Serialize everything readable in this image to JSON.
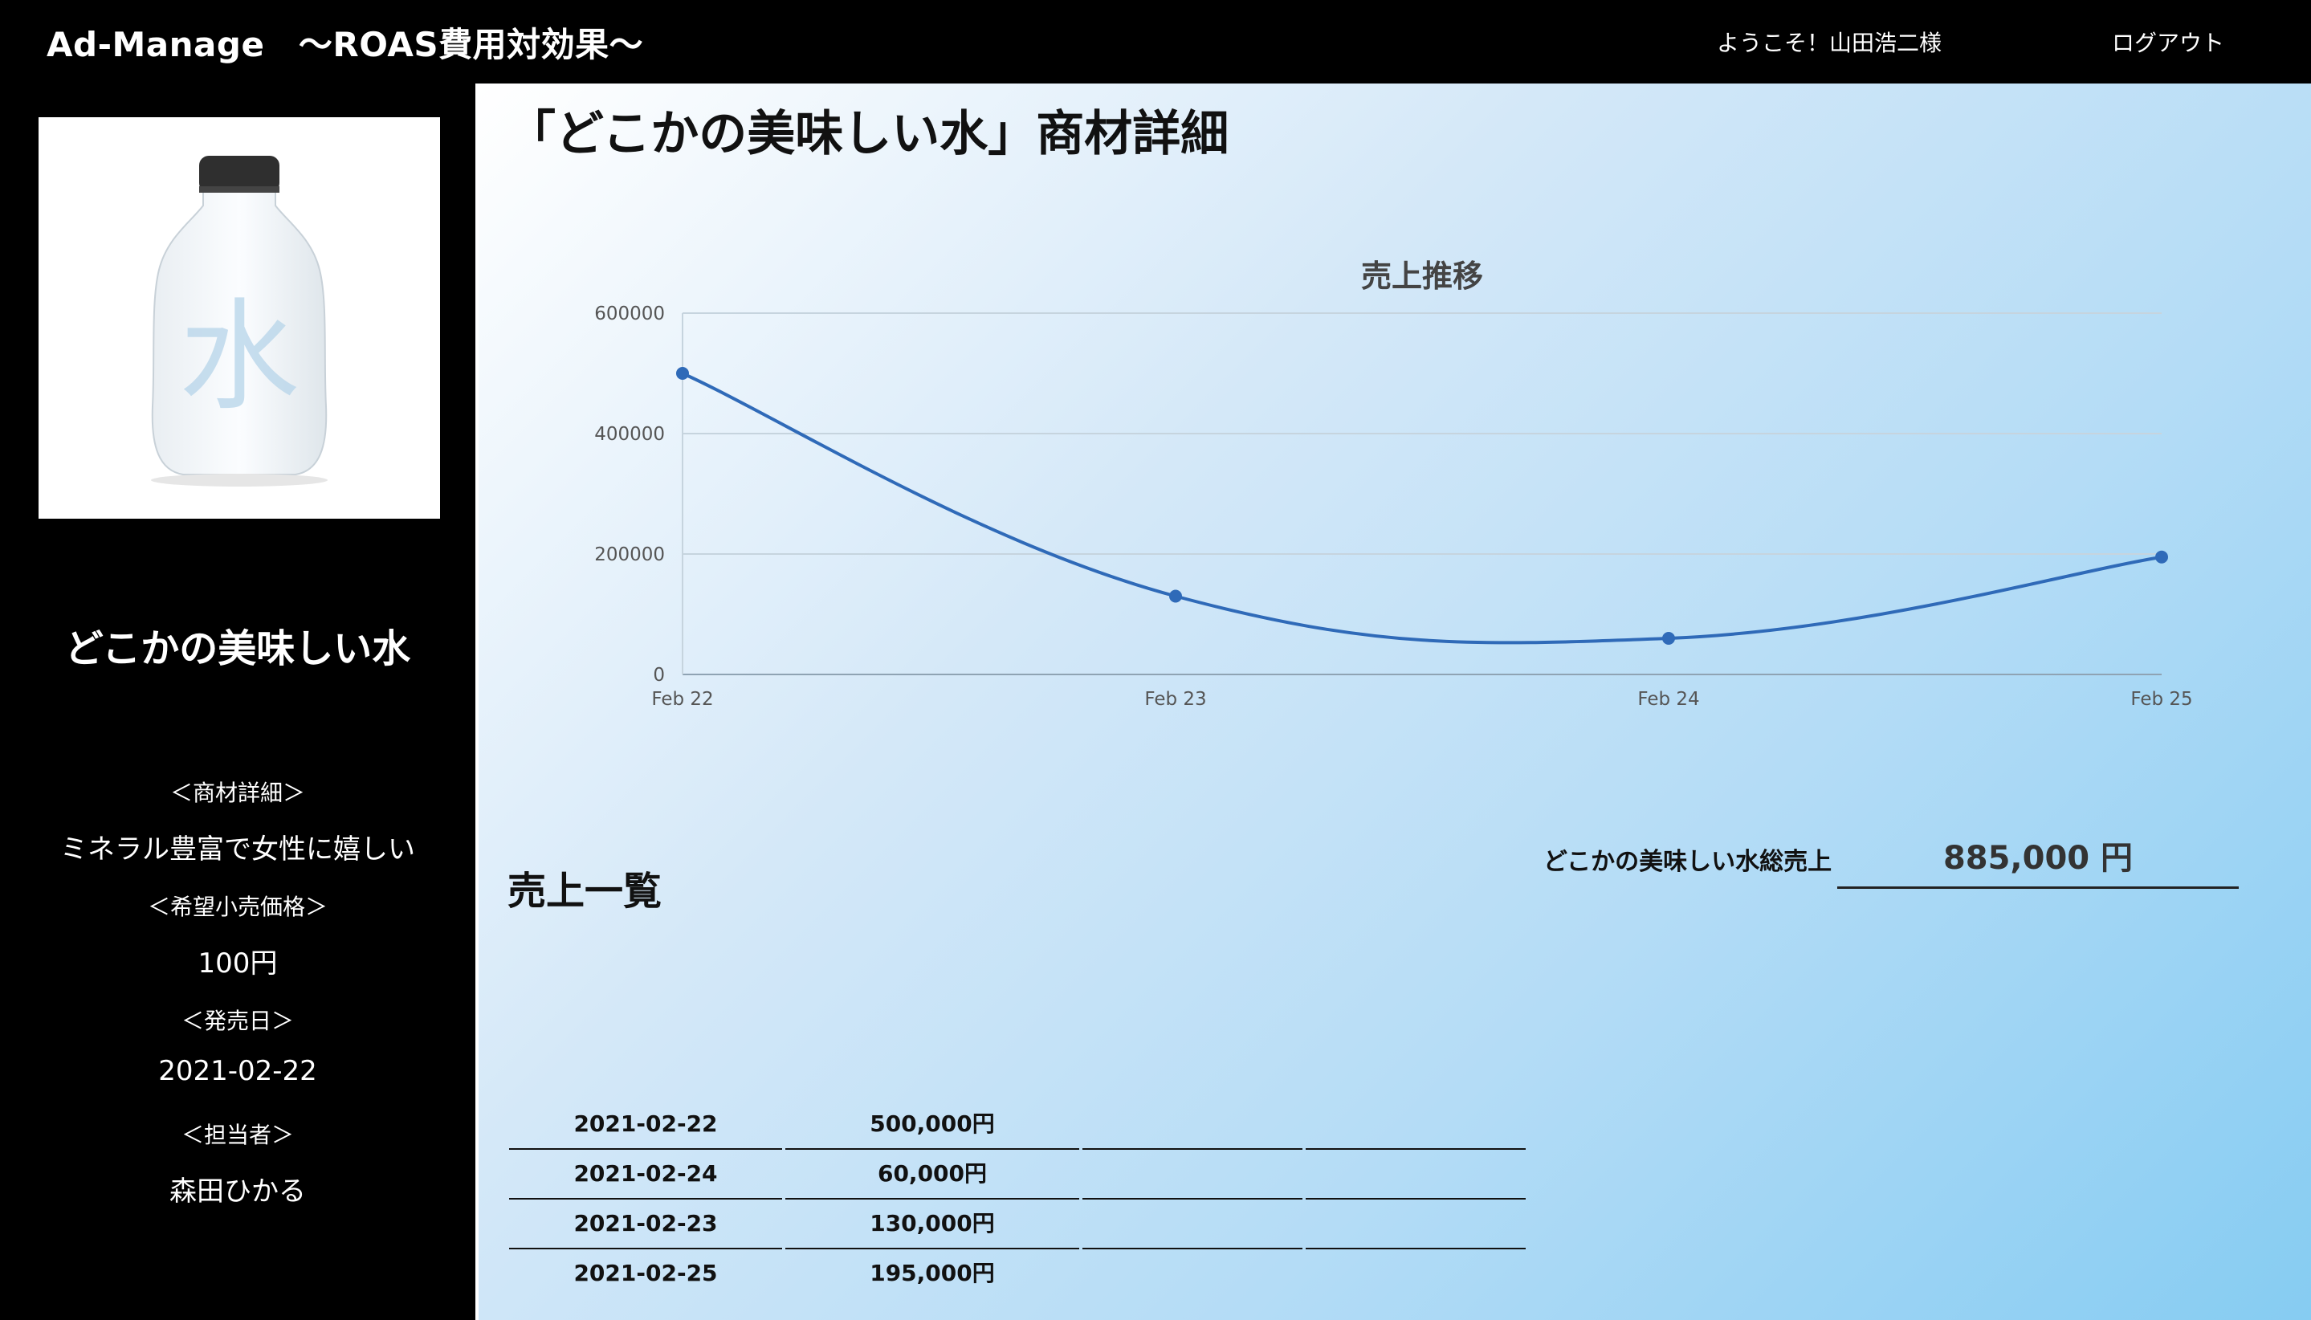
{
  "header": {
    "brand": "Ad-Manage　〜ROAS費用対効果〜",
    "welcome": "ようこそ！山田浩二様",
    "logout": "ログアウト"
  },
  "sidebar": {
    "image_glyph": "水",
    "product_name": "どこかの美味しい水",
    "detail_label": "＜商材詳細＞",
    "detail_value": "ミネラル豊富で女性に嬉しい",
    "price_label": "＜希望小売価格＞",
    "price_value": "100円",
    "release_label": "＜発売日＞",
    "release_value": "2021-02-22",
    "person_label": "＜担当者＞",
    "person_value": "森田ひかる"
  },
  "main": {
    "page_title": "「どこかの美味しい水」商材詳細",
    "sales_list_title": "売上一覧",
    "total_label": "どこかの美味しい水総売上",
    "total_value": "885,000 円"
  },
  "chart_data": {
    "type": "line",
    "title": "売上推移",
    "xlabel": "",
    "ylabel": "",
    "categories": [
      "Feb 22",
      "Feb 23",
      "Feb 24",
      "Feb 25"
    ],
    "values": [
      500000,
      130000,
      60000,
      195000
    ],
    "ylim": [
      0,
      600000
    ],
    "yticks": [
      "0",
      "200000",
      "400000",
      "600000"
    ],
    "grid": true,
    "smooth": true,
    "color": "#2f6ab8"
  },
  "sales_table": {
    "rows": [
      {
        "date": "2021-02-22",
        "amount": "500,000円"
      },
      {
        "date": "2021-02-24",
        "amount": "60,000円"
      },
      {
        "date": "2021-02-23",
        "amount": "130,000円"
      },
      {
        "date": "2021-02-25",
        "amount": "195,000円"
      }
    ]
  },
  "colors": {
    "header_bg": "#000000",
    "sidebar_bg": "#000000",
    "chart_line": "#2f6ab8",
    "gradient_end": "#86ccf2"
  }
}
